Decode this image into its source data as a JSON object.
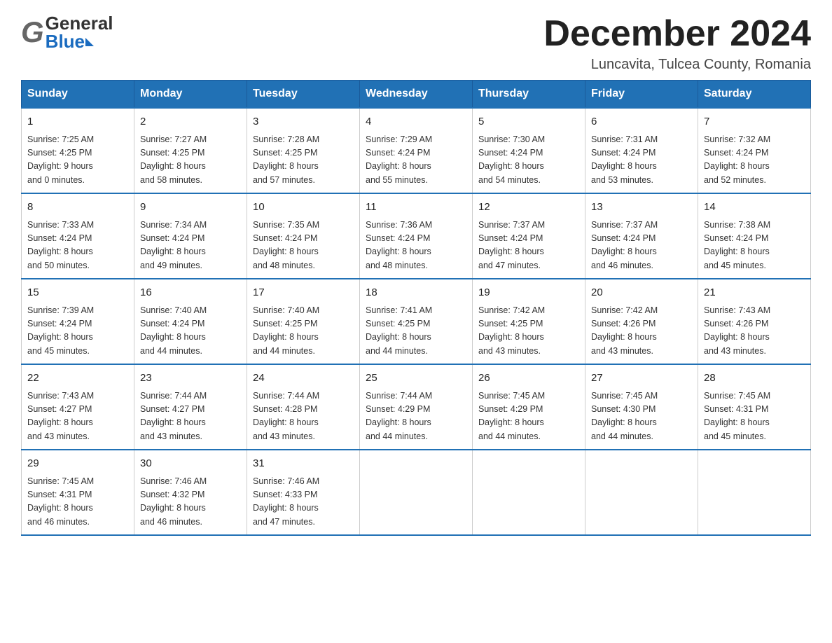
{
  "header": {
    "logo_general": "General",
    "logo_blue": "Blue",
    "month_title": "December 2024",
    "location": "Luncavita, Tulcea County, Romania"
  },
  "weekdays": [
    "Sunday",
    "Monday",
    "Tuesday",
    "Wednesday",
    "Thursday",
    "Friday",
    "Saturday"
  ],
  "weeks": [
    [
      {
        "day": "1",
        "sunrise": "7:25 AM",
        "sunset": "4:25 PM",
        "daylight": "9 hours and 0 minutes."
      },
      {
        "day": "2",
        "sunrise": "7:27 AM",
        "sunset": "4:25 PM",
        "daylight": "8 hours and 58 minutes."
      },
      {
        "day": "3",
        "sunrise": "7:28 AM",
        "sunset": "4:25 PM",
        "daylight": "8 hours and 57 minutes."
      },
      {
        "day": "4",
        "sunrise": "7:29 AM",
        "sunset": "4:24 PM",
        "daylight": "8 hours and 55 minutes."
      },
      {
        "day": "5",
        "sunrise": "7:30 AM",
        "sunset": "4:24 PM",
        "daylight": "8 hours and 54 minutes."
      },
      {
        "day": "6",
        "sunrise": "7:31 AM",
        "sunset": "4:24 PM",
        "daylight": "8 hours and 53 minutes."
      },
      {
        "day": "7",
        "sunrise": "7:32 AM",
        "sunset": "4:24 PM",
        "daylight": "8 hours and 52 minutes."
      }
    ],
    [
      {
        "day": "8",
        "sunrise": "7:33 AM",
        "sunset": "4:24 PM",
        "daylight": "8 hours and 50 minutes."
      },
      {
        "day": "9",
        "sunrise": "7:34 AM",
        "sunset": "4:24 PM",
        "daylight": "8 hours and 49 minutes."
      },
      {
        "day": "10",
        "sunrise": "7:35 AM",
        "sunset": "4:24 PM",
        "daylight": "8 hours and 48 minutes."
      },
      {
        "day": "11",
        "sunrise": "7:36 AM",
        "sunset": "4:24 PM",
        "daylight": "8 hours and 48 minutes."
      },
      {
        "day": "12",
        "sunrise": "7:37 AM",
        "sunset": "4:24 PM",
        "daylight": "8 hours and 47 minutes."
      },
      {
        "day": "13",
        "sunrise": "7:37 AM",
        "sunset": "4:24 PM",
        "daylight": "8 hours and 46 minutes."
      },
      {
        "day": "14",
        "sunrise": "7:38 AM",
        "sunset": "4:24 PM",
        "daylight": "8 hours and 45 minutes."
      }
    ],
    [
      {
        "day": "15",
        "sunrise": "7:39 AM",
        "sunset": "4:24 PM",
        "daylight": "8 hours and 45 minutes."
      },
      {
        "day": "16",
        "sunrise": "7:40 AM",
        "sunset": "4:24 PM",
        "daylight": "8 hours and 44 minutes."
      },
      {
        "day": "17",
        "sunrise": "7:40 AM",
        "sunset": "4:25 PM",
        "daylight": "8 hours and 44 minutes."
      },
      {
        "day": "18",
        "sunrise": "7:41 AM",
        "sunset": "4:25 PM",
        "daylight": "8 hours and 44 minutes."
      },
      {
        "day": "19",
        "sunrise": "7:42 AM",
        "sunset": "4:25 PM",
        "daylight": "8 hours and 43 minutes."
      },
      {
        "day": "20",
        "sunrise": "7:42 AM",
        "sunset": "4:26 PM",
        "daylight": "8 hours and 43 minutes."
      },
      {
        "day": "21",
        "sunrise": "7:43 AM",
        "sunset": "4:26 PM",
        "daylight": "8 hours and 43 minutes."
      }
    ],
    [
      {
        "day": "22",
        "sunrise": "7:43 AM",
        "sunset": "4:27 PM",
        "daylight": "8 hours and 43 minutes."
      },
      {
        "day": "23",
        "sunrise": "7:44 AM",
        "sunset": "4:27 PM",
        "daylight": "8 hours and 43 minutes."
      },
      {
        "day": "24",
        "sunrise": "7:44 AM",
        "sunset": "4:28 PM",
        "daylight": "8 hours and 43 minutes."
      },
      {
        "day": "25",
        "sunrise": "7:44 AM",
        "sunset": "4:29 PM",
        "daylight": "8 hours and 44 minutes."
      },
      {
        "day": "26",
        "sunrise": "7:45 AM",
        "sunset": "4:29 PM",
        "daylight": "8 hours and 44 minutes."
      },
      {
        "day": "27",
        "sunrise": "7:45 AM",
        "sunset": "4:30 PM",
        "daylight": "8 hours and 44 minutes."
      },
      {
        "day": "28",
        "sunrise": "7:45 AM",
        "sunset": "4:31 PM",
        "daylight": "8 hours and 45 minutes."
      }
    ],
    [
      {
        "day": "29",
        "sunrise": "7:45 AM",
        "sunset": "4:31 PM",
        "daylight": "8 hours and 46 minutes."
      },
      {
        "day": "30",
        "sunrise": "7:46 AM",
        "sunset": "4:32 PM",
        "daylight": "8 hours and 46 minutes."
      },
      {
        "day": "31",
        "sunrise": "7:46 AM",
        "sunset": "4:33 PM",
        "daylight": "8 hours and 47 minutes."
      },
      null,
      null,
      null,
      null
    ]
  ],
  "labels": {
    "sunrise": "Sunrise:",
    "sunset": "Sunset:",
    "daylight": "Daylight:"
  }
}
